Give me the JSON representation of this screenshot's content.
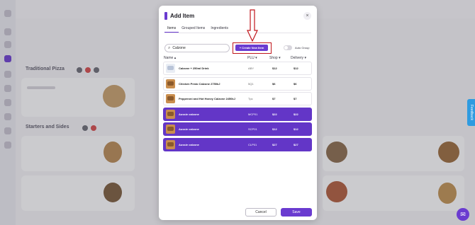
{
  "modal": {
    "title": "Add Item",
    "close_label": "×",
    "tabs": [
      {
        "label": "Items"
      },
      {
        "label": "Grouped Items"
      },
      {
        "label": "Ingredients"
      }
    ],
    "search": {
      "value": "Calzone",
      "placeholder": "Search"
    },
    "create_button": "+ Create New Item",
    "auto_group_label": "Auto Group",
    "columns": {
      "name": "Name ▴",
      "plu": "PLU ▾",
      "shop": "Shop ▾",
      "delivery": "Delivery ▾"
    },
    "rows": [
      {
        "name": "Calzone + 250ml Drink",
        "plu": "ABY",
        "shop": "$12",
        "delivery": "$12",
        "selected": false
      },
      {
        "name": "Chicken Pesto Calzone 2750kJ",
        "plu": "5Q1",
        "shop": "$6",
        "delivery": "$6",
        "selected": false
      },
      {
        "name": "Pepperoni and Hot Honey Calzone 2450kJ",
        "plu": "Tpc",
        "shop": "$7",
        "delivery": "$7",
        "selected": false
      },
      {
        "name": "Aussie calzone",
        "plu": "MCP01",
        "shop": "$22",
        "delivery": "$22",
        "selected": true
      },
      {
        "name": "Aussie calzone",
        "plu": "SCP01",
        "shop": "$12",
        "delivery": "$12",
        "selected": true
      },
      {
        "name": "Aussie calzone",
        "plu": "CLP01",
        "shop": "$27",
        "delivery": "$27",
        "selected": true
      }
    ],
    "cancel_label": "Cancel",
    "save_label": "Save"
  },
  "background": {
    "section_1": "Traditional Pizza",
    "section_2": "Starters and Sides",
    "feedback_label": "Feedback"
  },
  "colors": {
    "accent": "#6a3bd0",
    "highlight": "#c0161c"
  },
  "icons": {
    "search": "search-icon",
    "close": "close-icon",
    "arrow": "down-arrow-icon",
    "chat": "chat-icon"
  }
}
